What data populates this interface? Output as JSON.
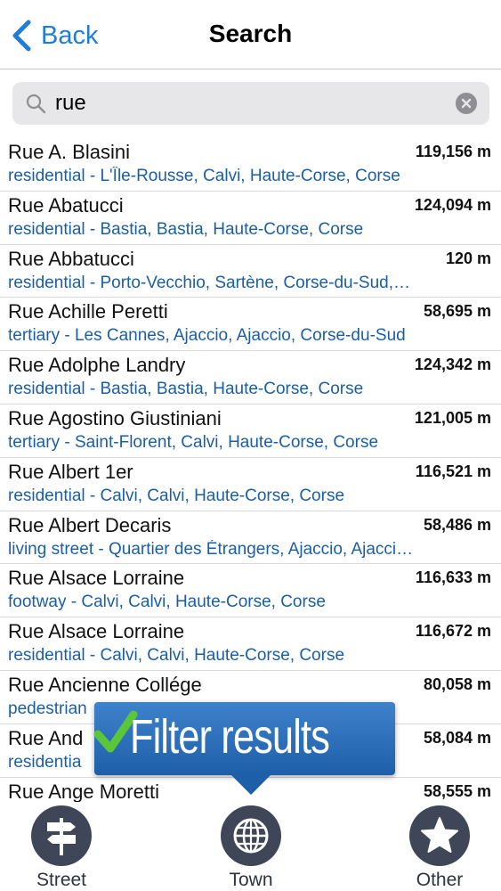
{
  "nav": {
    "back_label": "Back",
    "title": "Search"
  },
  "search": {
    "value": "rue",
    "placeholder": ""
  },
  "results": [
    {
      "name": "Rue A. Blasini",
      "distance": "119,156 m",
      "detail": "residential - L'Île-Rousse, Calvi, Haute-Corse, Corse"
    },
    {
      "name": "Rue Abatucci",
      "distance": "124,094 m",
      "detail": "residential - Bastia, Bastia, Haute-Corse, Corse"
    },
    {
      "name": "Rue Abbatucci",
      "distance": "120 m",
      "detail": "residential - Porto-Vecchio, Sartène, Corse-du-Sud,…"
    },
    {
      "name": "Rue Achille Peretti",
      "distance": "58,695 m",
      "detail": "tertiary - Les Cannes, Ajaccio, Ajaccio, Corse-du-Sud"
    },
    {
      "name": "Rue Adolphe Landry",
      "distance": "124,342 m",
      "detail": "residential - Bastia, Bastia, Haute-Corse, Corse"
    },
    {
      "name": "Rue Agostino Giustiniani",
      "distance": "121,005 m",
      "detail": "tertiary - Saint-Florent, Calvi, Haute-Corse, Corse"
    },
    {
      "name": "Rue Albert 1er",
      "distance": "116,521 m",
      "detail": "residential - Calvi, Calvi, Haute-Corse, Corse"
    },
    {
      "name": "Rue Albert Decaris",
      "distance": "58,486 m",
      "detail": "living street - Quartier des Étrangers, Ajaccio, Ajacci…"
    },
    {
      "name": "Rue Alsace Lorraine",
      "distance": "116,633 m",
      "detail": "footway - Calvi, Calvi, Haute-Corse, Corse"
    },
    {
      "name": "Rue Alsace Lorraine",
      "distance": "116,672 m",
      "detail": "residential - Calvi, Calvi, Haute-Corse, Corse"
    },
    {
      "name": "Rue Ancienne Collége",
      "distance": "80,058 m",
      "detail": "pedestrian                                                  se"
    },
    {
      "name": "Rue And",
      "distance": "58,084 m",
      "detail": "residentia                                              orse-du-…"
    },
    {
      "name": "Rue Ange Moretti",
      "distance": "58,555 m",
      "detail": ""
    }
  ],
  "tooltip": {
    "text": "Filter results"
  },
  "tabs": [
    {
      "label": "Street",
      "icon": "signpost-icon"
    },
    {
      "label": "Town",
      "icon": "globe-icon"
    },
    {
      "label": "Other",
      "icon": "star-icon"
    }
  ],
  "colors": {
    "accent": "#1f7cd8",
    "detail_text": "#1a5fa6",
    "tooltip_bg": "#2f72be",
    "tab_icon_bg": "#3e4657",
    "check_green": "#5cc63a"
  }
}
